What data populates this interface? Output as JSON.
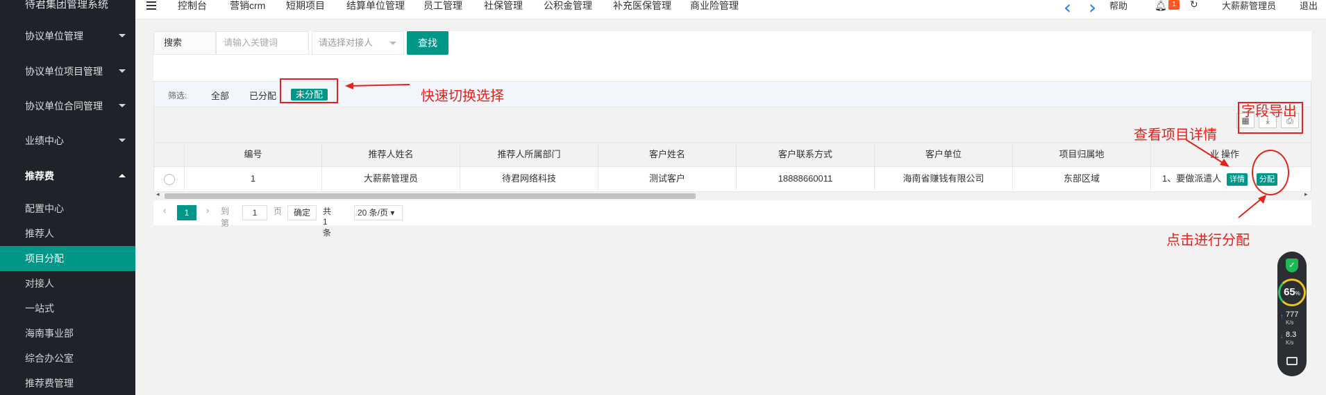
{
  "sidebar": {
    "brand": "待君集团管理系统",
    "menus": [
      "协议单位管理",
      "协议单位项目管理",
      "协议单位合同管理",
      "业绩中心",
      "推荐费"
    ],
    "sub_items": [
      "配置中心",
      "推荐人",
      "项目分配",
      "对接人",
      "一站式",
      "海南事业部",
      "综合办公室",
      "推荐费管理"
    ],
    "active_sub": "项目分配"
  },
  "topbar": {
    "nav": [
      "控制台",
      "营销crm",
      "短期项目",
      "结算单位管理",
      "员工管理",
      "社保管理",
      "公积金管理",
      "补充医保管理",
      "商业险管理"
    ],
    "help": "帮助",
    "notification_count": "1",
    "user": "大薪薪管理员",
    "logout": "退出"
  },
  "search": {
    "label": "搜索",
    "placeholder": "请输入关键词",
    "select_placeholder": "请选择对接人",
    "button": "查找"
  },
  "filter": {
    "label": "筛选:",
    "options": [
      "全部",
      "已分配",
      "未分配"
    ],
    "active": "未分配"
  },
  "table": {
    "columns": [
      "编号",
      "推荐人姓名",
      "推荐人所属部门",
      "客户姓名",
      "客户联系方式",
      "客户单位",
      "项目归属地",
      "业",
      "操作"
    ],
    "rows": [
      {
        "id": "1",
        "referrer": "大薪薪管理员",
        "dept": "待君网络科技",
        "customer": "测试客户",
        "phone": "18888660011",
        "company": "海南省赚钱有限公司",
        "region": "东部区域",
        "extra": "1、要做派遣人",
        "actions": [
          "详情",
          "分配"
        ]
      }
    ]
  },
  "pager": {
    "current": "1",
    "goto_label": "到第",
    "page_input": "1",
    "page_unit": "页",
    "confirm": "确定",
    "total": "共 1 条",
    "page_size": "20 条/页"
  },
  "annotations": {
    "quick_switch": "快速切换选择",
    "field_export": "字段导出",
    "view_detail": "查看项目详情",
    "click_assign": "点击进行分配"
  },
  "widget": {
    "percent": "65",
    "percent_unit": "%",
    "up_speed": "777",
    "down_speed": "8.3",
    "speed_unit": "K/s"
  },
  "colors": {
    "sidebar_bg": "#20222a",
    "accent": "#009688",
    "annotation": "#e3231a",
    "badge": "#ff5722"
  }
}
